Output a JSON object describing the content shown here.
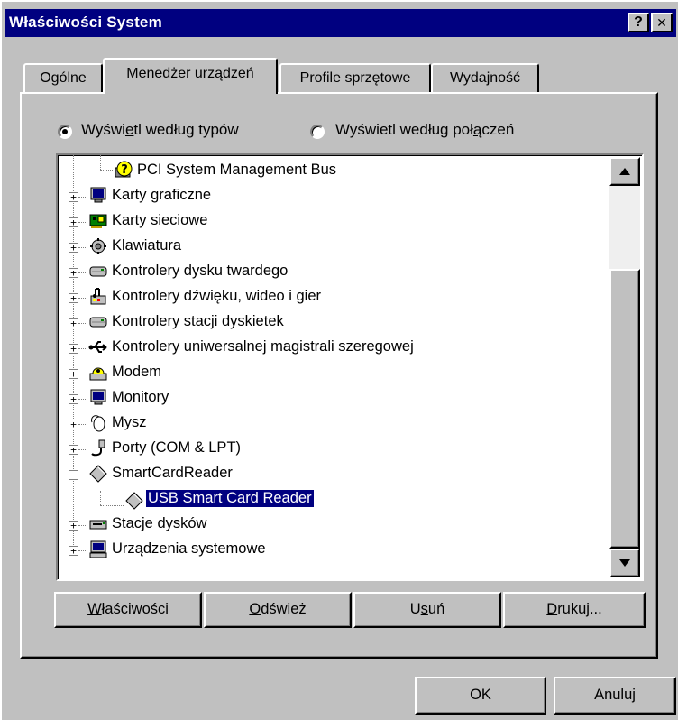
{
  "window": {
    "title": "Właściwości System",
    "help_label": "?",
    "close_label": "✕"
  },
  "tabs": [
    {
      "label": "Ogólne",
      "active": false
    },
    {
      "label": "Menedżer urządzeń",
      "active": true
    },
    {
      "label": "Profile sprzętowe",
      "active": false
    },
    {
      "label": "Wydajność",
      "active": false
    }
  ],
  "view_options": {
    "by_type": {
      "pre": "Wyświ",
      "ul": "e",
      "post": "tl według typów",
      "selected": true
    },
    "by_connection": {
      "pre": "Wyświetl według poł",
      "ul": "ą",
      "post": "czeń",
      "selected": false
    }
  },
  "tree": {
    "items": [
      {
        "label": "PCI System Management Bus",
        "icon": "question-device-icon",
        "level": 1,
        "expander": "none",
        "selected": false
      },
      {
        "label": "Karty graficzne",
        "icon": "display-adapter-icon",
        "level": 0,
        "expander": "plus",
        "selected": false
      },
      {
        "label": "Karty sieciowe",
        "icon": "network-card-icon",
        "level": 0,
        "expander": "plus",
        "selected": false
      },
      {
        "label": "Klawiatura",
        "icon": "keyboard-icon",
        "level": 0,
        "expander": "plus",
        "selected": false
      },
      {
        "label": "Kontrolery dysku twardego",
        "icon": "disk-controller-icon",
        "level": 0,
        "expander": "plus",
        "selected": false
      },
      {
        "label": "Kontrolery dźwięku, wideo i gier",
        "icon": "sound-icon",
        "level": 0,
        "expander": "plus",
        "selected": false
      },
      {
        "label": "Kontrolery stacji dyskietek",
        "icon": "floppy-controller-icon",
        "level": 0,
        "expander": "plus",
        "selected": false
      },
      {
        "label": "Kontrolery uniwersalnej magistrali szeregowej",
        "icon": "usb-icon",
        "level": 0,
        "expander": "plus",
        "selected": false
      },
      {
        "label": "Modem",
        "icon": "modem-icon",
        "level": 0,
        "expander": "plus",
        "selected": false
      },
      {
        "label": "Monitory",
        "icon": "monitor-icon",
        "level": 0,
        "expander": "plus",
        "selected": false
      },
      {
        "label": "Mysz",
        "icon": "mouse-icon",
        "level": 0,
        "expander": "plus",
        "selected": false
      },
      {
        "label": "Porty (COM & LPT)",
        "icon": "port-icon",
        "level": 0,
        "expander": "plus",
        "selected": false
      },
      {
        "label": "SmartCardReader",
        "icon": "diamond-device-icon",
        "level": 0,
        "expander": "minus",
        "selected": false
      },
      {
        "label": "USB Smart Card Reader",
        "icon": "diamond-device-icon",
        "level": 1,
        "expander": "none",
        "selected": true
      },
      {
        "label": "Stacje dysków",
        "icon": "disk-drive-icon",
        "level": 0,
        "expander": "plus",
        "selected": false
      },
      {
        "label": "Urządzenia systemowe",
        "icon": "system-device-icon",
        "level": 0,
        "expander": "plus",
        "selected": false
      }
    ]
  },
  "actions": {
    "properties": {
      "ul": "W",
      "rest": "łaściwości"
    },
    "refresh": {
      "ul": "O",
      "rest": "dśwież"
    },
    "remove": {
      "pre": "U",
      "ul": "s",
      "rest": "uń"
    },
    "print": {
      "ul": "D",
      "rest": "rukuj..."
    }
  },
  "dialog": {
    "ok_label": "OK",
    "cancel_label": "Anuluj"
  }
}
